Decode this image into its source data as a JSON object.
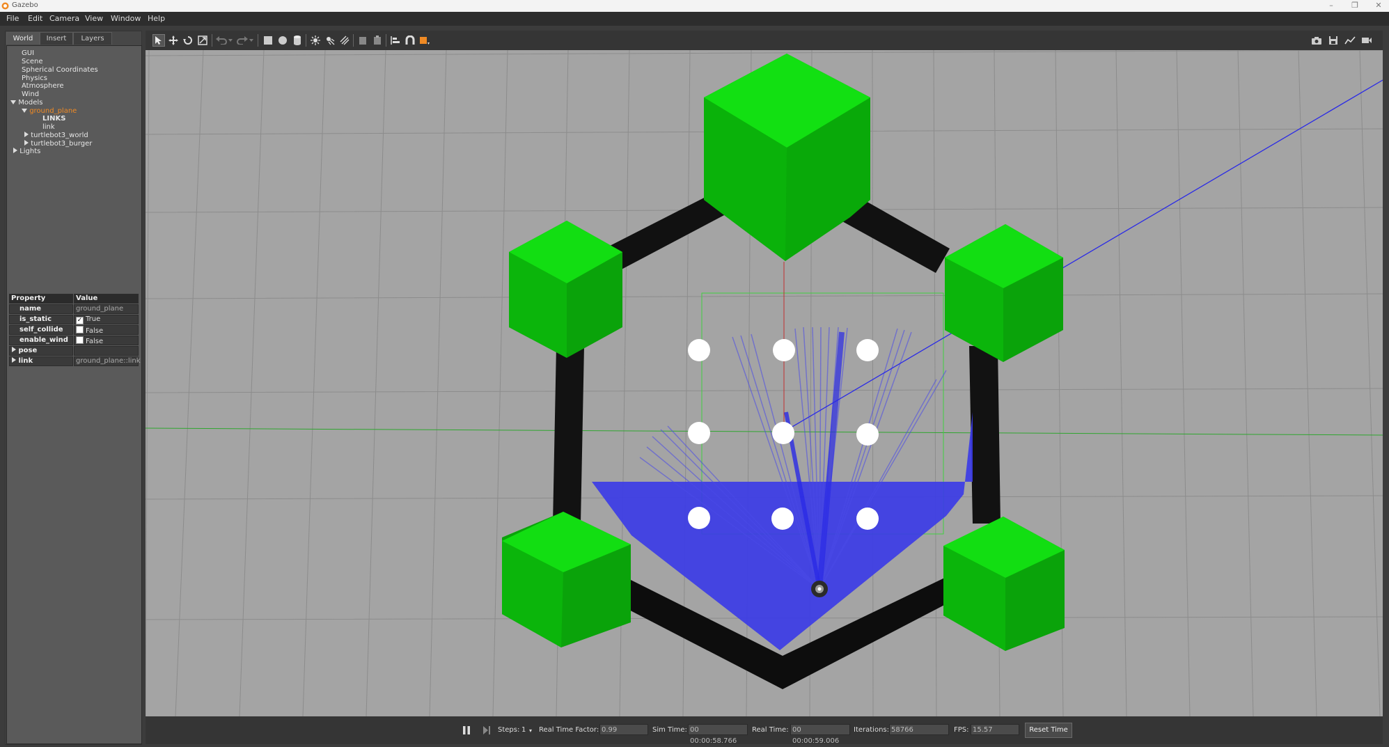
{
  "window": {
    "title": "Gazebo"
  },
  "menu": [
    "File",
    "Edit",
    "Camera",
    "View",
    "Window",
    "Help"
  ],
  "tabs": [
    "World",
    "Insert",
    "Layers"
  ],
  "tree": {
    "gui": "GUI",
    "scene": "Scene",
    "spherical": "Spherical Coordinates",
    "physics": "Physics",
    "atmosphere": "Atmosphere",
    "wind": "Wind",
    "models": "Models",
    "ground_plane": "ground_plane",
    "links": "LINKS",
    "link": "link",
    "turtlebot3_world": "turtlebot3_world",
    "turtlebot3_burger": "turtlebot3_burger",
    "lights": "Lights"
  },
  "properties": {
    "header": {
      "property": "Property",
      "value": "Value"
    },
    "rows": [
      {
        "name": "name",
        "value": "ground_plane"
      },
      {
        "name": "is_static",
        "value": "True",
        "checked": true
      },
      {
        "name": "self_collide",
        "value": "False",
        "checked": false
      },
      {
        "name": "enable_wind",
        "value": "False",
        "checked": false
      },
      {
        "name": "pose",
        "value": ""
      },
      {
        "name": "link",
        "value": "ground_plane::link"
      }
    ]
  },
  "toolbar": {
    "icons": [
      "select-arrow-icon",
      "translate-icon",
      "rotate-icon",
      "scale-icon",
      "undo-icon",
      "redo-icon",
      "box-icon",
      "sphere-icon",
      "cylinder-icon",
      "point-light-icon",
      "spot-light-icon",
      "directional-light-icon",
      "copy-icon",
      "paste-icon",
      "align-icon",
      "snap-icon",
      "view-angle-icon"
    ],
    "right_icons": [
      "screenshot-icon",
      "log-icon",
      "plot-icon",
      "video-record-icon"
    ]
  },
  "status": {
    "steps_label": "Steps:",
    "steps_value": "1",
    "rtf_label": "Real Time Factor:",
    "rtf_value": "0.99",
    "sim_time_label": "Sim Time:",
    "sim_time_value": "00 00:00:58.766",
    "real_time_label": "Real Time:",
    "real_time_value": "00 00:00:59.006",
    "iterations_label": "Iterations:",
    "iterations_value": "58766",
    "fps_label": "FPS:",
    "fps_value": "15.57",
    "reset_label": "Reset Time"
  },
  "colors": {
    "accent": "#f08a24",
    "laser": "#2a2ae6",
    "obstacle": "#12c012",
    "wall": "#111111",
    "ground": "#a4a4a4"
  }
}
